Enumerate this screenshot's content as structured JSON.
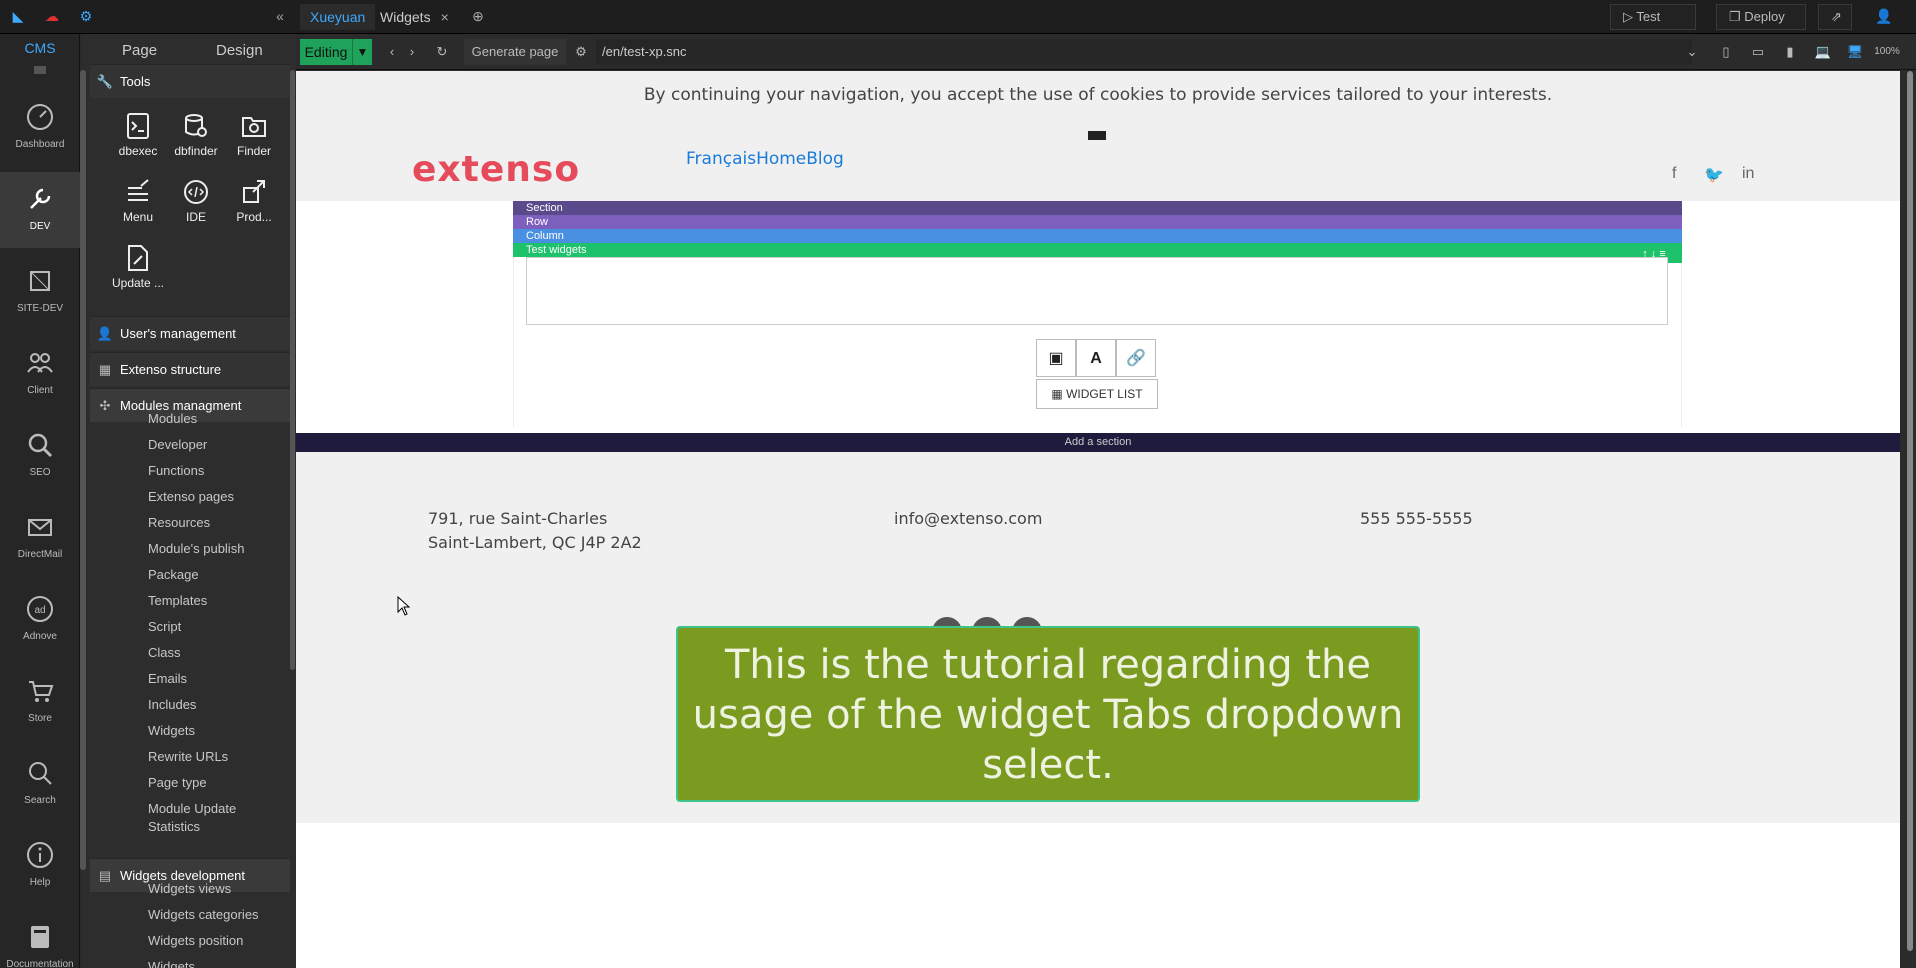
{
  "topbar": {
    "tabs": [
      {
        "label": "Xueyuan"
      },
      {
        "label": "Widgets",
        "close": "×"
      }
    ],
    "collapse_icon": "«",
    "add_tab_icon": "⊕",
    "test_label": "Test",
    "deploy_label": "Deploy"
  },
  "rail": {
    "head": "CMS",
    "items": [
      {
        "label": "Dashboard",
        "icon": "gauge-icon"
      },
      {
        "label": "DEV",
        "icon": "wrench-icon"
      },
      {
        "label": "SITE-DEV",
        "icon": "cube-icon"
      },
      {
        "label": "Client",
        "icon": "users-icon"
      },
      {
        "label": "SEO",
        "icon": "seo-icon"
      },
      {
        "label": "DirectMail",
        "icon": "mail-icon"
      },
      {
        "label": "Adnove",
        "icon": "ad-icon"
      },
      {
        "label": "Store",
        "icon": "cart-icon"
      },
      {
        "label": "Search",
        "icon": "search-icon"
      },
      {
        "label": "Help",
        "icon": "info-icon"
      },
      {
        "label": "Documentation",
        "icon": "book-icon"
      }
    ]
  },
  "panel": {
    "tab_page": "Page",
    "tab_design": "Design",
    "tools_header": "Tools",
    "tools": [
      {
        "label": "dbexec"
      },
      {
        "label": "dbfinder"
      },
      {
        "label": "Finder"
      },
      {
        "label": "Menu"
      },
      {
        "label": "IDE"
      },
      {
        "label": "Prod..."
      },
      {
        "label": "Update ..."
      }
    ],
    "users_header": "User's management",
    "structure_header": "Extenso structure",
    "modules_header": "Modules managment",
    "module_items": [
      "Modules",
      "Developer",
      "Functions",
      "Extenso pages",
      "Resources",
      "Module's publish",
      "Package",
      "Templates",
      "Script",
      "Class",
      "Emails",
      "Includes",
      "Widgets",
      "Rewrite URLs",
      "Page type",
      "Module Update Statistics"
    ],
    "widgets_dev_header": "Widgets development",
    "widgets_dev_items": [
      "Widgets views",
      "Widgets categories",
      "Widgets position",
      "Widgets"
    ]
  },
  "editor_toolbar": {
    "mode": "Editing",
    "generate_label": "Generate page",
    "url": "/en/test-xp.snc",
    "zoom": "100%"
  },
  "page": {
    "cookie_text": "By continuing your navigation, you accept the use of cookies to provide services tailored to your interests.",
    "logo": "extenso",
    "nav_links": "FrançaisHomeBlog",
    "social": [
      "f",
      "🐦",
      "in"
    ],
    "bars": {
      "section": "Section",
      "row": "Row",
      "column": "Column",
      "widget": "Test widgets"
    },
    "widget_list_label": "WIDGET LIST",
    "add_section": "Add a section",
    "address_line1": "791, rue Saint-Charles",
    "address_line2": "Saint-Lambert, QC J4P 2A2",
    "email": "info@extenso.com",
    "phone": "555 555-5555",
    "tutorial_text": "This is the tutorial regarding the usage of the widget Tabs dropdown select."
  },
  "colors": {
    "accent_blue": "#3da9ff",
    "editing_green": "#1fa35a",
    "logo_red": "#e64b5c",
    "tutorial_green": "#7a9a20"
  }
}
